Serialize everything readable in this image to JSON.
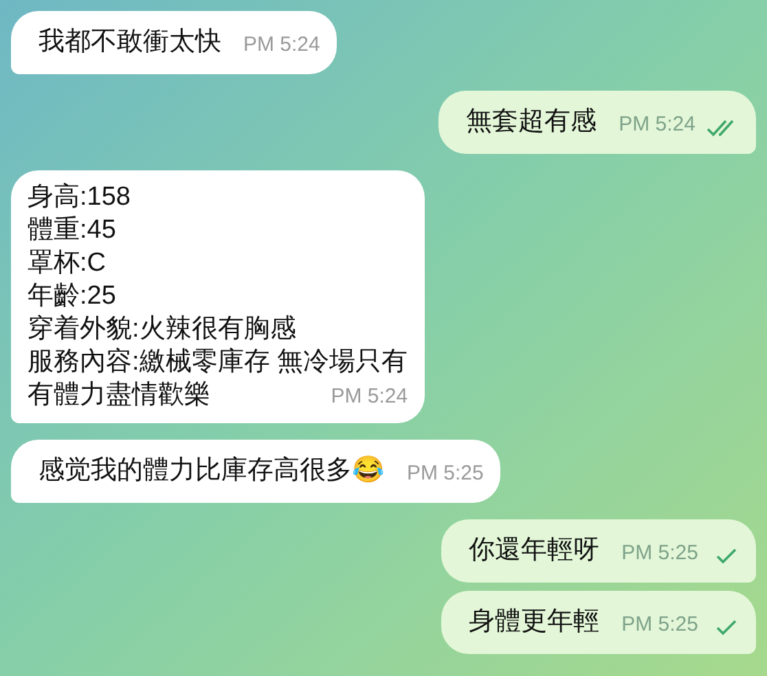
{
  "messages": [
    {
      "kind": "incoming",
      "lines": [
        "我都不敢衝太快"
      ],
      "time": "PM 5:24"
    },
    {
      "kind": "outgoing",
      "lines": [
        "無套超有感"
      ],
      "time": "PM 5:24",
      "read": true
    },
    {
      "kind": "incoming",
      "lines": [
        "身高:158",
        "體重:45",
        "罩杯:C",
        "年齡:25",
        "穿着外貌:火辣很有胸感",
        "服務內容:繳械零庫存 無冷場只有",
        "有體力盡情歡樂"
      ],
      "time": "PM 5:24"
    },
    {
      "kind": "incoming",
      "lines": [
        "感觉我的體力比庫存高很多😂"
      ],
      "time": "PM 5:25"
    },
    {
      "kind": "outgoing",
      "lines": [
        "你還年輕呀"
      ],
      "time": "PM 5:25",
      "read": false
    },
    {
      "kind": "outgoing",
      "lines": [
        "身體更年輕"
      ],
      "time": "PM 5:25",
      "read": false
    }
  ]
}
